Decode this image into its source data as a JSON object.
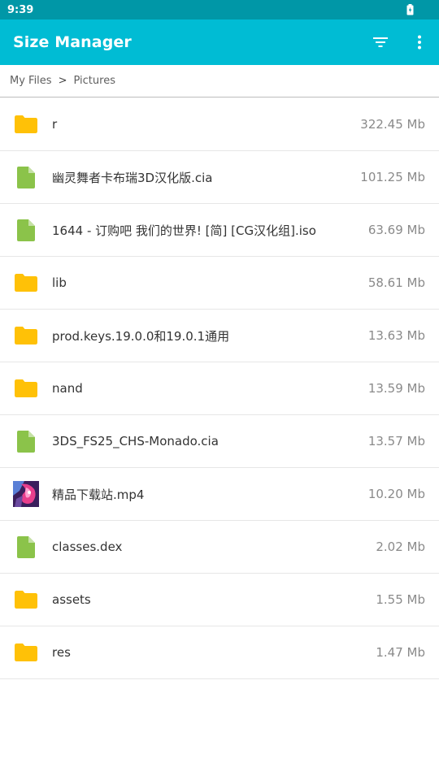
{
  "status_bar": {
    "time": "9:39",
    "battery_icon": "battery-icon"
  },
  "app_bar": {
    "title": "Size Manager",
    "filter_icon": "filter-icon",
    "more_icon": "more-vert-icon",
    "color": "#00bcd4"
  },
  "breadcrumb": {
    "items": [
      "My Files",
      "Pictures"
    ],
    "separator": ">"
  },
  "files": [
    {
      "name": "r",
      "size": "322.45 Mb",
      "type": "folder"
    },
    {
      "name": "幽灵舞者卡布瑞3D汉化版.cia",
      "size": "101.25 Mb",
      "type": "file"
    },
    {
      "name": "1644 - 订购吧 我们的世界! [简] [CG汉化组].iso",
      "size": "63.69 Mb",
      "type": "file"
    },
    {
      "name": "lib",
      "size": "58.61 Mb",
      "type": "folder"
    },
    {
      "name": "prod.keys.19.0.0和19.0.1通用",
      "size": "13.63 Mb",
      "type": "folder"
    },
    {
      "name": "nand",
      "size": "13.59 Mb",
      "type": "folder"
    },
    {
      "name": "3DS_FS25_CHS-Monado.cia",
      "size": "13.57 Mb",
      "type": "file"
    },
    {
      "name": "精品下载站.mp4",
      "size": "10.20 Mb",
      "type": "video"
    },
    {
      "name": "classes.dex",
      "size": "2.02 Mb",
      "type": "file"
    },
    {
      "name": "assets",
      "size": "1.55 Mb",
      "type": "folder"
    },
    {
      "name": "res",
      "size": "1.47 Mb",
      "type": "folder"
    }
  ],
  "colors": {
    "folder": "#ffc107",
    "file": "#8bc34a",
    "status_bar": "#0097a7"
  }
}
